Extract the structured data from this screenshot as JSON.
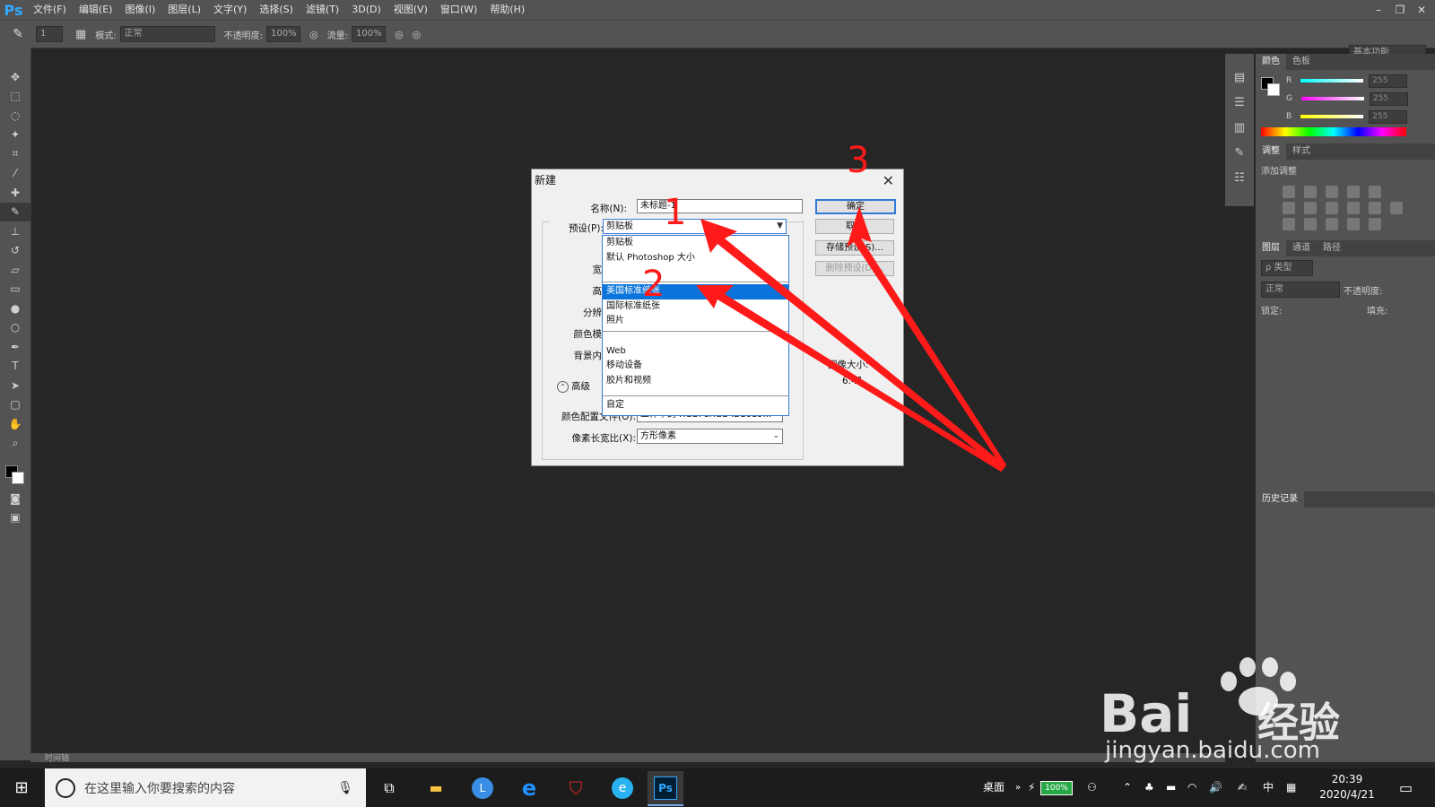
{
  "app": {
    "logo": "Ps"
  },
  "menubar": {
    "items": [
      "文件(F)",
      "编辑(E)",
      "图像(I)",
      "图层(L)",
      "文字(Y)",
      "选择(S)",
      "滤镜(T)",
      "3D(D)",
      "视图(V)",
      "窗口(W)",
      "帮助(H)"
    ]
  },
  "options": {
    "brush_size": "1",
    "mode_label": "模式:",
    "mode_value": "正常",
    "opacity_label": "不透明度:",
    "opacity_value": "100%",
    "flow_label": "流量:",
    "flow_value": "100%",
    "workspace": "基本功能"
  },
  "panels": {
    "color_tabs": [
      "颜色",
      "色板"
    ],
    "r_label": "R",
    "g_label": "G",
    "b_label": "B",
    "r_value": "255",
    "g_value": "255",
    "b_value": "255",
    "adjust_tabs": [
      "调整",
      "样式"
    ],
    "adjust_title": "添加调整",
    "layers_tabs": [
      "图层",
      "通道",
      "路径"
    ],
    "layers_filter": "ρ 类型",
    "blend_mode": "正常",
    "opacity_label": "不透明度:",
    "lock_label": "锁定:",
    "fill_label": "填充:",
    "history_tab": "历史记录"
  },
  "timeline": {
    "label": "时间轴"
  },
  "dialog": {
    "title": "新建",
    "name_label": "名称(N):",
    "name_value": "未标题-1",
    "preset_label": "预设(P):",
    "preset_value": "剪贴板",
    "ok": "确定",
    "cancel": "取消",
    "save_preset": "存储预设(S)...",
    "delete_preset": "删除预设(D)...",
    "advanced": "高级",
    "color_profile_label": "颜色配置文件(O):",
    "color_profile_value": "工作中的 RGB: sRGB IEC619...",
    "pixel_aspect_label": "像素长宽比(X):",
    "pixel_aspect_value": "方形像素",
    "image_size_label": "图像大小:",
    "image_size_value": "6.41",
    "partial_labels": [
      "宽",
      "高",
      "分辨",
      "颜色模",
      "背景内"
    ],
    "dropdown": [
      "剪贴板",
      "默认 Photoshop 大小",
      "美国标准纸张",
      "国际标准纸张",
      "照片",
      "Web",
      "移动设备",
      "胶片和视频",
      "自定"
    ]
  },
  "annotations": [
    "1",
    "2",
    "3"
  ],
  "taskbar": {
    "search_placeholder": "在这里输入你要搜索的内容",
    "desktop": "桌面",
    "battery": "100%",
    "ime": "中",
    "time": "20:39",
    "date": "2020/4/21"
  },
  "watermark": {
    "brand": "Bai",
    "brand_cn": "经验",
    "url": "jingyan.baidu.com"
  },
  "colors": {
    "ps_blue": "#31a8ff",
    "highlight": "#0a74da",
    "annotation": "#ff1a1a"
  }
}
